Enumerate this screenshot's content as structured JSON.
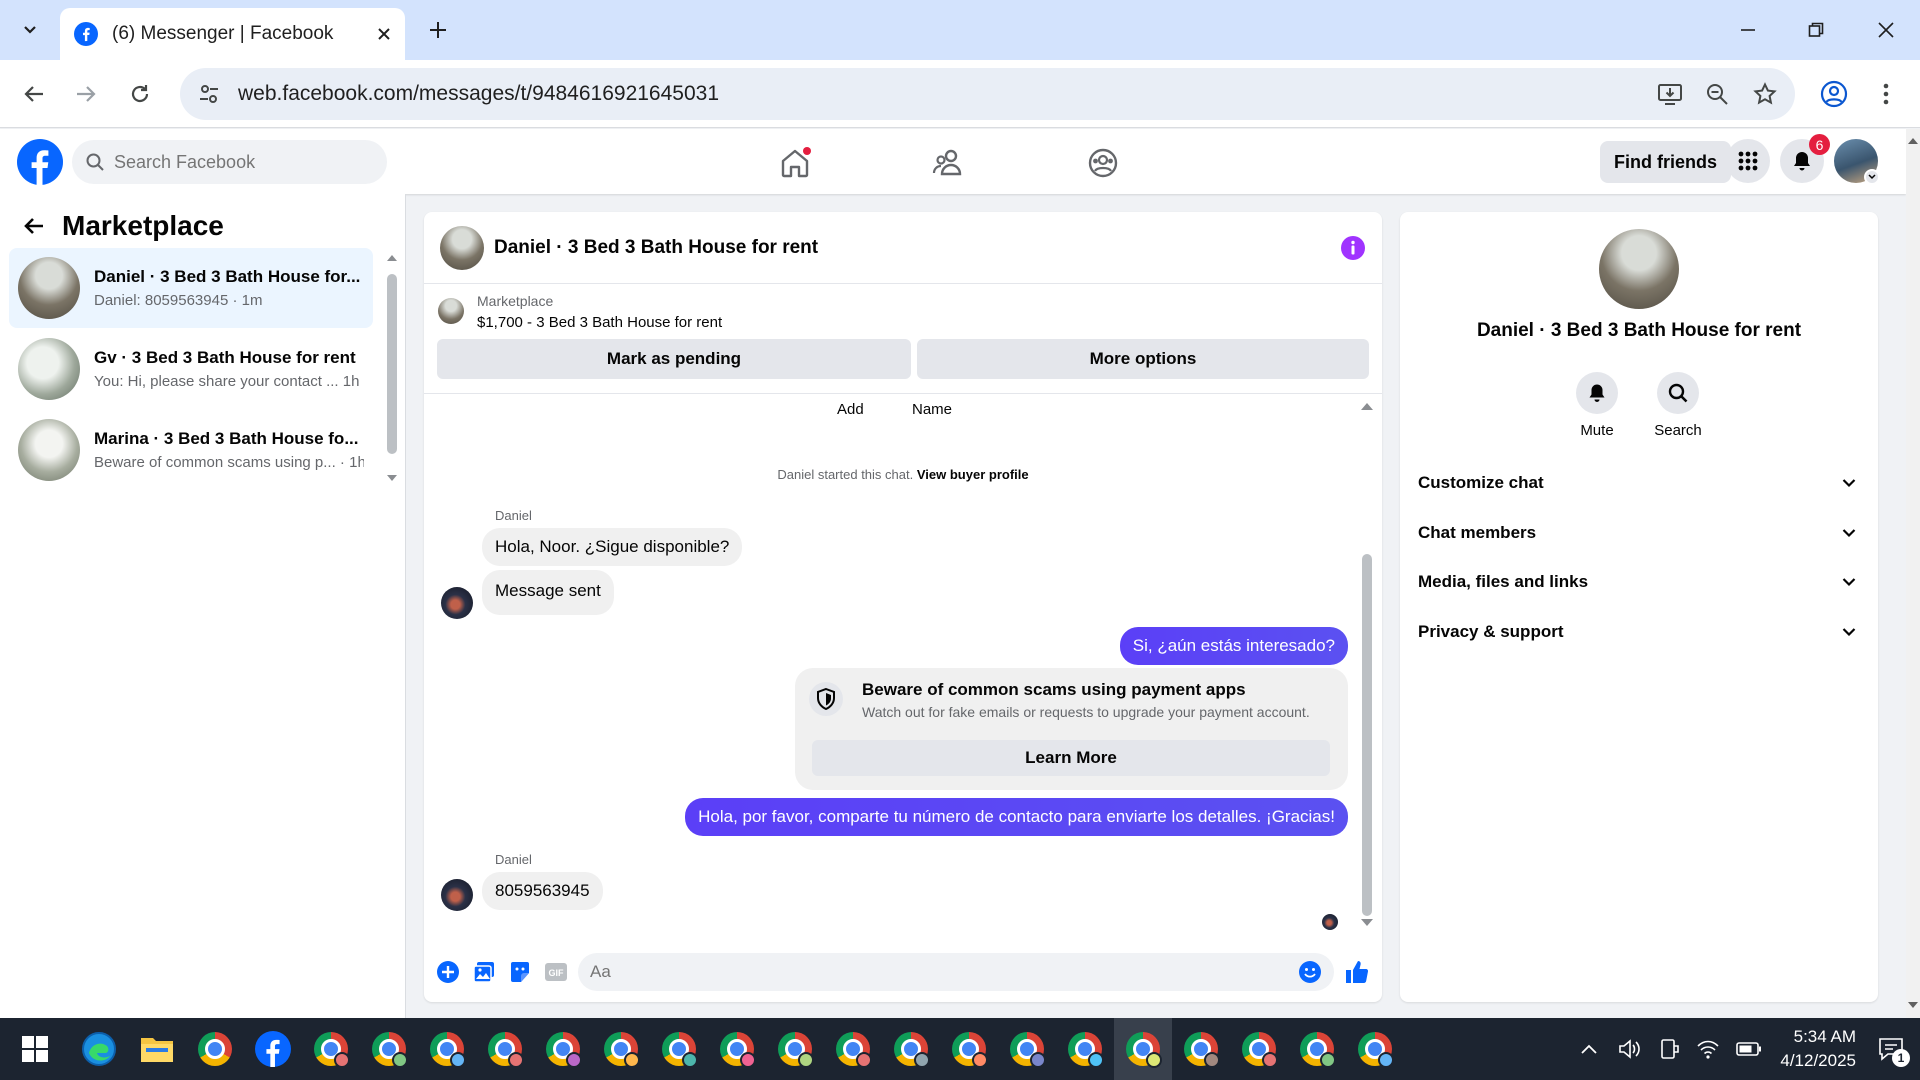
{
  "browser": {
    "tab_title": "(6) Messenger | Facebook",
    "url": "web.facebook.com/messages/t/9484616921645031"
  },
  "header": {
    "search_placeholder": "Search Facebook",
    "find_friends": "Find friends",
    "notification_count": "6"
  },
  "sidebar": {
    "title": "Marketplace",
    "conversations": [
      {
        "name": "Daniel · 3 Bed 3 Bath House for...",
        "preview": "Daniel: 8059563945 · 1m"
      },
      {
        "name": "Gv · 3 Bed 3 Bath House for rent",
        "preview": "You: Hi, please share your contact ... 1h"
      },
      {
        "name": "Marina · 3 Bed 3 Bath House fo...",
        "preview": "Beware of common scams using p... · 1h"
      }
    ]
  },
  "chat": {
    "title": "Daniel · 3 Bed 3 Bath House for rent",
    "listing_label": "Marketplace",
    "listing_title": "$1,700 - 3 Bed 3 Bath House for rent",
    "mark_pending": "Mark as pending",
    "more_options": "More options",
    "col_add": "Add",
    "col_name": "Name",
    "started_text": "Daniel started this chat.",
    "view_profile": "View buyer profile",
    "sender1": "Daniel",
    "msg1": "Hola, Noor. ¿Sigue disponible?",
    "msg2": "Message sent",
    "msg3": "Si, ¿aún estás interesado?",
    "scam_title": "Beware of common scams using payment apps",
    "scam_text": "Watch out for fake emails or requests to upgrade your payment account.",
    "learn_more": "Learn More",
    "msg4": "Hola, por favor, comparte tu número de contacto para enviarte los detalles. ¡Gracias!",
    "sender2": "Daniel",
    "msg5": "8059563945",
    "composer_placeholder": "Aa"
  },
  "info_panel": {
    "title": "Daniel · 3 Bed 3 Bath House for rent",
    "mute": "Mute",
    "search": "Search",
    "sections": [
      "Customize chat",
      "Chat members",
      "Media, files and links",
      "Privacy & support"
    ]
  },
  "taskbar": {
    "time": "5:34 AM",
    "date": "4/12/2025",
    "notification_count": "1"
  },
  "colors": {
    "fb_blue": "#0866ff",
    "outgoing_bubble": "#5b47f5",
    "info_purple": "#a033ff"
  }
}
